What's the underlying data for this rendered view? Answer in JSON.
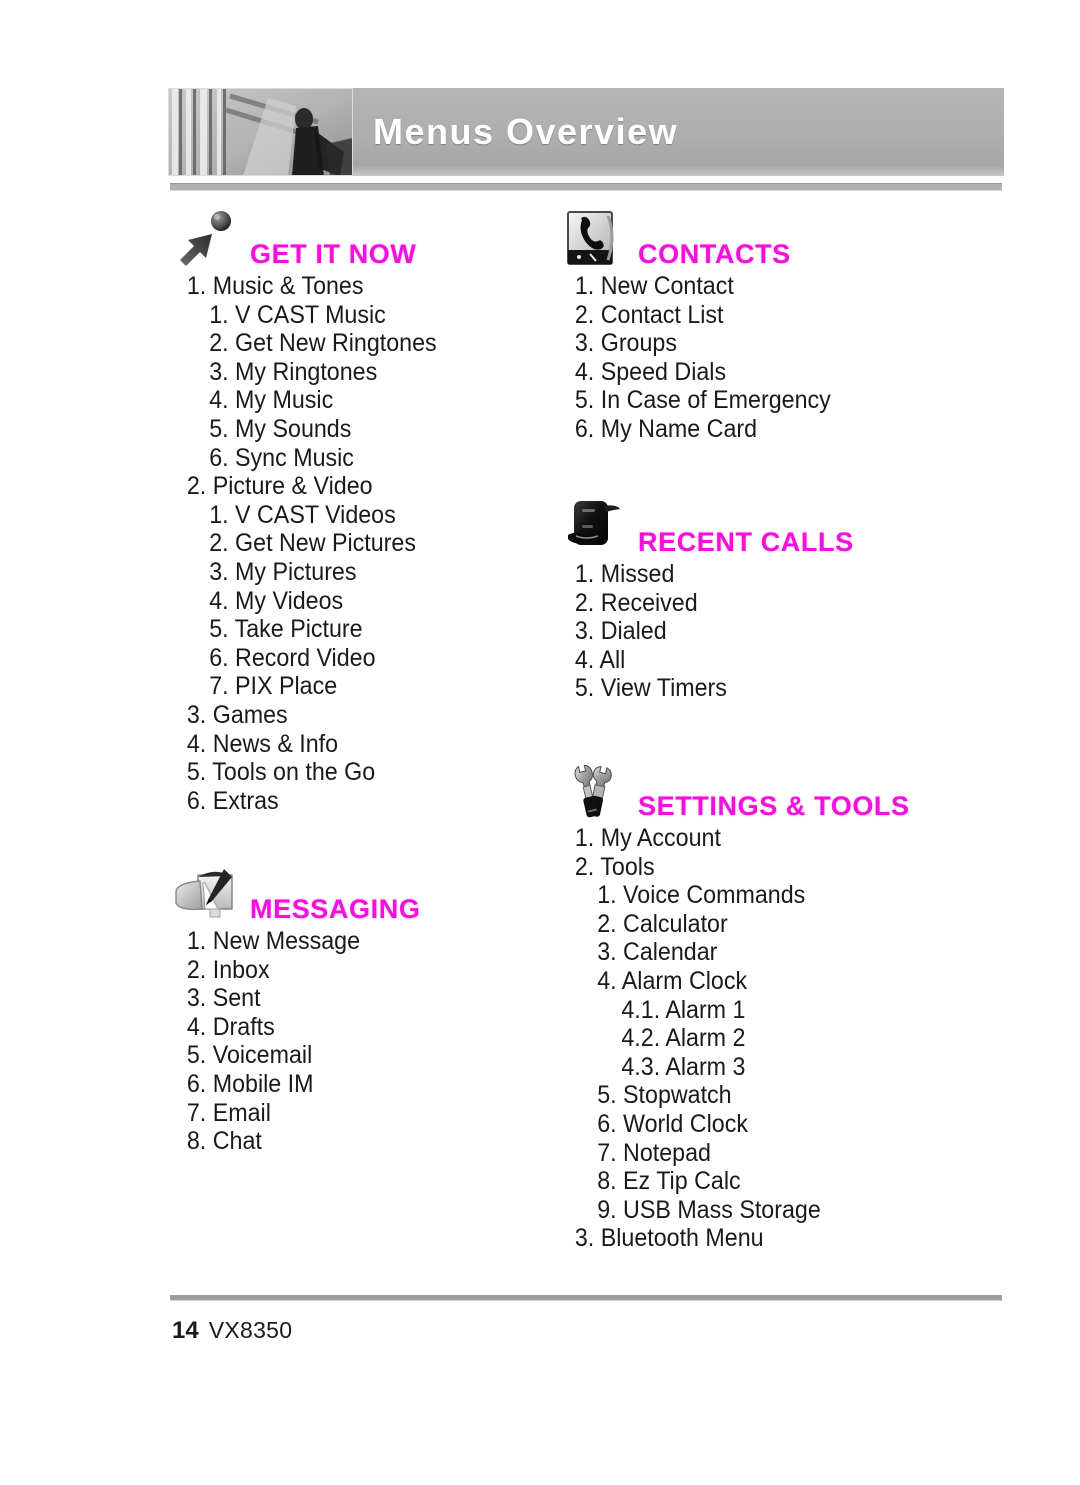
{
  "header": {
    "title": "Menus Overview",
    "photo_alt": "bamboo-poles-photo"
  },
  "footer": {
    "page_number": "14",
    "model": "VX8350"
  },
  "accent_color": "#f012d8",
  "columns": {
    "left": [
      {
        "id": "get-it-now",
        "title": "GET IT NOW",
        "icon": "arrow-with-ball-icon",
        "items": [
          {
            "level": 1,
            "text": "1. Music & Tones"
          },
          {
            "level": 2,
            "text": "1. V CAST Music"
          },
          {
            "level": 2,
            "text": "2. Get New Ringtones"
          },
          {
            "level": 2,
            "text": "3. My Ringtones"
          },
          {
            "level": 2,
            "text": "4. My Music"
          },
          {
            "level": 2,
            "text": "5. My Sounds"
          },
          {
            "level": 2,
            "text": "6. Sync Music"
          },
          {
            "level": 1,
            "text": "2. Picture & Video"
          },
          {
            "level": 2,
            "text": "1. V CAST Videos"
          },
          {
            "level": 2,
            "text": "2. Get New Pictures"
          },
          {
            "level": 2,
            "text": "3. My Pictures"
          },
          {
            "level": 2,
            "text": "4. My Videos"
          },
          {
            "level": 2,
            "text": "5. Take Picture"
          },
          {
            "level": 2,
            "text": "6. Record Video"
          },
          {
            "level": 2,
            "text": "7. PIX Place"
          },
          {
            "level": 1,
            "text": "3. Games"
          },
          {
            "level": 1,
            "text": "4. News & Info"
          },
          {
            "level": 1,
            "text": "5. Tools on the Go"
          },
          {
            "level": 1,
            "text": "6. Extras"
          }
        ]
      },
      {
        "id": "messaging",
        "title": "MESSAGING",
        "icon": "mailbox-with-pen-icon",
        "items": [
          {
            "level": 1,
            "text": "1. New Message"
          },
          {
            "level": 1,
            "text": "2. Inbox"
          },
          {
            "level": 1,
            "text": "3. Sent"
          },
          {
            "level": 1,
            "text": "4. Drafts"
          },
          {
            "level": 1,
            "text": "5. Voicemail"
          },
          {
            "level": 1,
            "text": "6. Mobile IM"
          },
          {
            "level": 1,
            "text": "7. Email"
          },
          {
            "level": 1,
            "text": "8. Chat"
          }
        ]
      }
    ],
    "right": [
      {
        "id": "contacts",
        "title": "CONTACTS",
        "icon": "phone-handset-card-icon",
        "items": [
          {
            "level": 1,
            "text": "1. New Contact"
          },
          {
            "level": 1,
            "text": "2. Contact List"
          },
          {
            "level": 1,
            "text": "3. Groups"
          },
          {
            "level": 1,
            "text": "4. Speed Dials"
          },
          {
            "level": 1,
            "text": "5. In Case of Emergency"
          },
          {
            "level": 1,
            "text": "6. My Name Card"
          }
        ]
      },
      {
        "id": "recent-calls",
        "title": "RECENT CALLS",
        "icon": "flip-phone-icon",
        "items": [
          {
            "level": 1,
            "text": "1. Missed"
          },
          {
            "level": 1,
            "text": "2. Received"
          },
          {
            "level": 1,
            "text": "3. Dialed"
          },
          {
            "level": 1,
            "text": "4. All"
          },
          {
            "level": 1,
            "text": "5. View Timers"
          }
        ]
      },
      {
        "id": "settings-tools",
        "title": "SETTINGS & TOOLS",
        "icon": "wrench-screwdriver-icon",
        "items": [
          {
            "level": 1,
            "text": "1. My Account"
          },
          {
            "level": 1,
            "text": "2. Tools"
          },
          {
            "level": 2,
            "text": "1. Voice Commands"
          },
          {
            "level": 2,
            "text": "2. Calculator"
          },
          {
            "level": 2,
            "text": "3. Calendar"
          },
          {
            "level": 2,
            "text": "4. Alarm Clock"
          },
          {
            "level": 3,
            "text": "4.1. Alarm 1"
          },
          {
            "level": 3,
            "text": "4.2. Alarm 2"
          },
          {
            "level": 3,
            "text": "4.3. Alarm 3"
          },
          {
            "level": 2,
            "text": "5. Stopwatch"
          },
          {
            "level": 2,
            "text": "6. World Clock"
          },
          {
            "level": 2,
            "text": "7. Notepad"
          },
          {
            "level": 2,
            "text": "8. Ez Tip Calc"
          },
          {
            "level": 2,
            "text": "9. USB Mass Storage"
          },
          {
            "level": 1,
            "text": "3. Bluetooth Menu"
          }
        ]
      }
    ]
  }
}
